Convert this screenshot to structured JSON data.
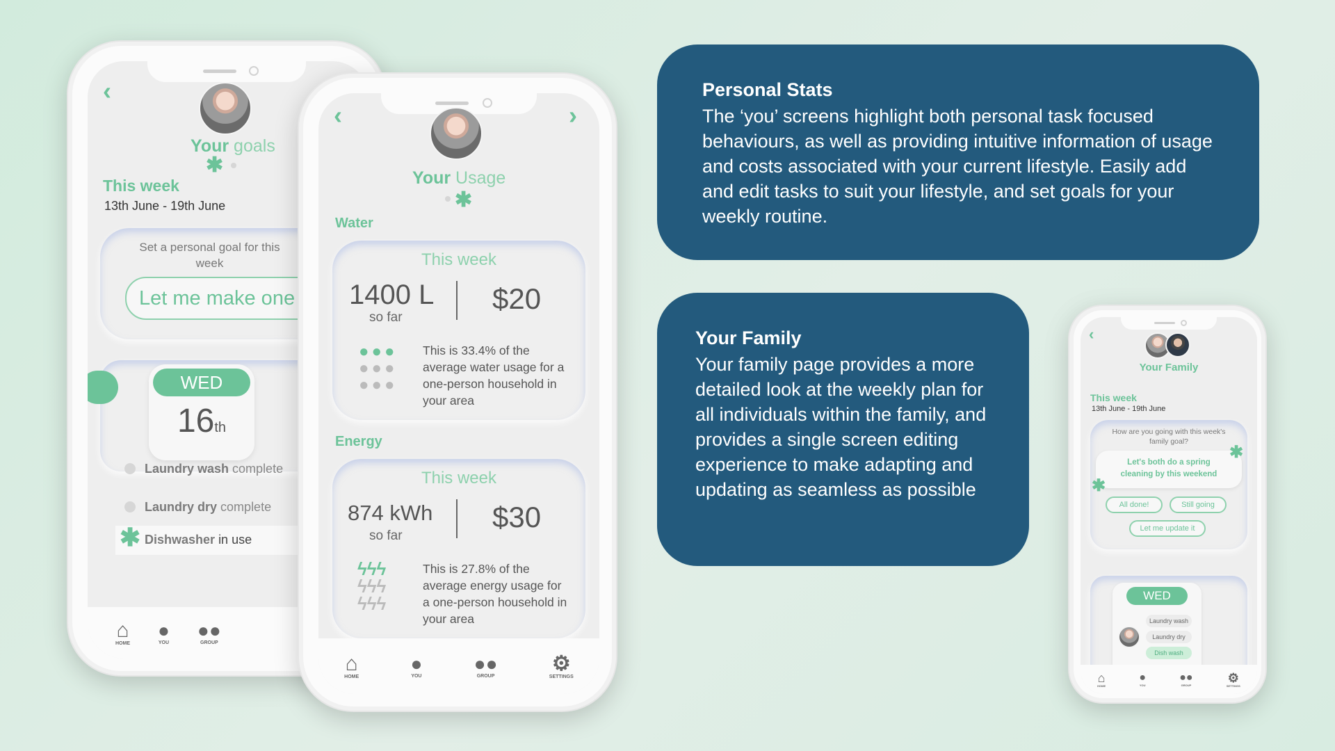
{
  "colors": {
    "accent": "#6cc399",
    "panel": "#235a7d",
    "background": "#d9ece2"
  },
  "goals_screen": {
    "title_your": "Your",
    "title_goals": "goals",
    "this_week": "This week",
    "date_range": "13th June - 19th June",
    "goal_prompt": "Set a personal goal for this week",
    "goal_button": "Let me make one",
    "day": "WED",
    "date_num": "16",
    "date_suffix": "th",
    "tasks": [
      {
        "name": "Laundry wash",
        "status": "complete"
      },
      {
        "name": "Laundry dry",
        "status": "complete"
      },
      {
        "name": "Dishwasher",
        "status": "in use"
      }
    ],
    "nav": [
      "HOME",
      "YOU",
      "GROUP"
    ]
  },
  "usage_screen": {
    "title_your": "Your",
    "title_usage": "Usage",
    "water": {
      "section": "Water",
      "card_title": "This week",
      "amount": "1400 L",
      "so_far": "so far",
      "cost": "$20",
      "description": "This is 33.4% of the average water usage for a one-person household in your area"
    },
    "energy": {
      "section": "Energy",
      "card_title": "This week",
      "amount": "874 kWh",
      "so_far": "so far",
      "cost": "$30",
      "description": "This is 27.8% of the average energy usage for a one-person household in your area"
    },
    "nav": [
      "HOME",
      "YOU",
      "GROUP",
      "SETTINGS"
    ]
  },
  "panel_personal": {
    "title": "Personal Stats",
    "text": "The ‘you’ screens highlight both personal task focused behaviours, as well as providing intuitive information of usage and costs associated with your current lifestyle. Easily add and edit tasks to suit your lifestyle, and set goals for your weekly routine."
  },
  "panel_family": {
    "title": "Your Family",
    "text": "Your family page provides a more detailed look at the weekly plan for all individuals within the family, and provides a single screen editing experience to make adapting and updating as seamless as possible"
  },
  "family_screen": {
    "title": "Your Family",
    "this_week": "This week",
    "date_range": "13th June - 19th June",
    "goal_question": "How are you going with this week's family goal?",
    "goal": "Let's both do a spring cleaning by this weekend",
    "btn_done": "All done!",
    "btn_going": "Still going",
    "btn_update": "Let me update it",
    "day": "WED",
    "tasks": [
      "Laundry wash",
      "Laundry dry",
      "Dish wash"
    ],
    "nav": [
      "HOME",
      "YOU",
      "GROUP",
      "SETTINGS"
    ]
  }
}
